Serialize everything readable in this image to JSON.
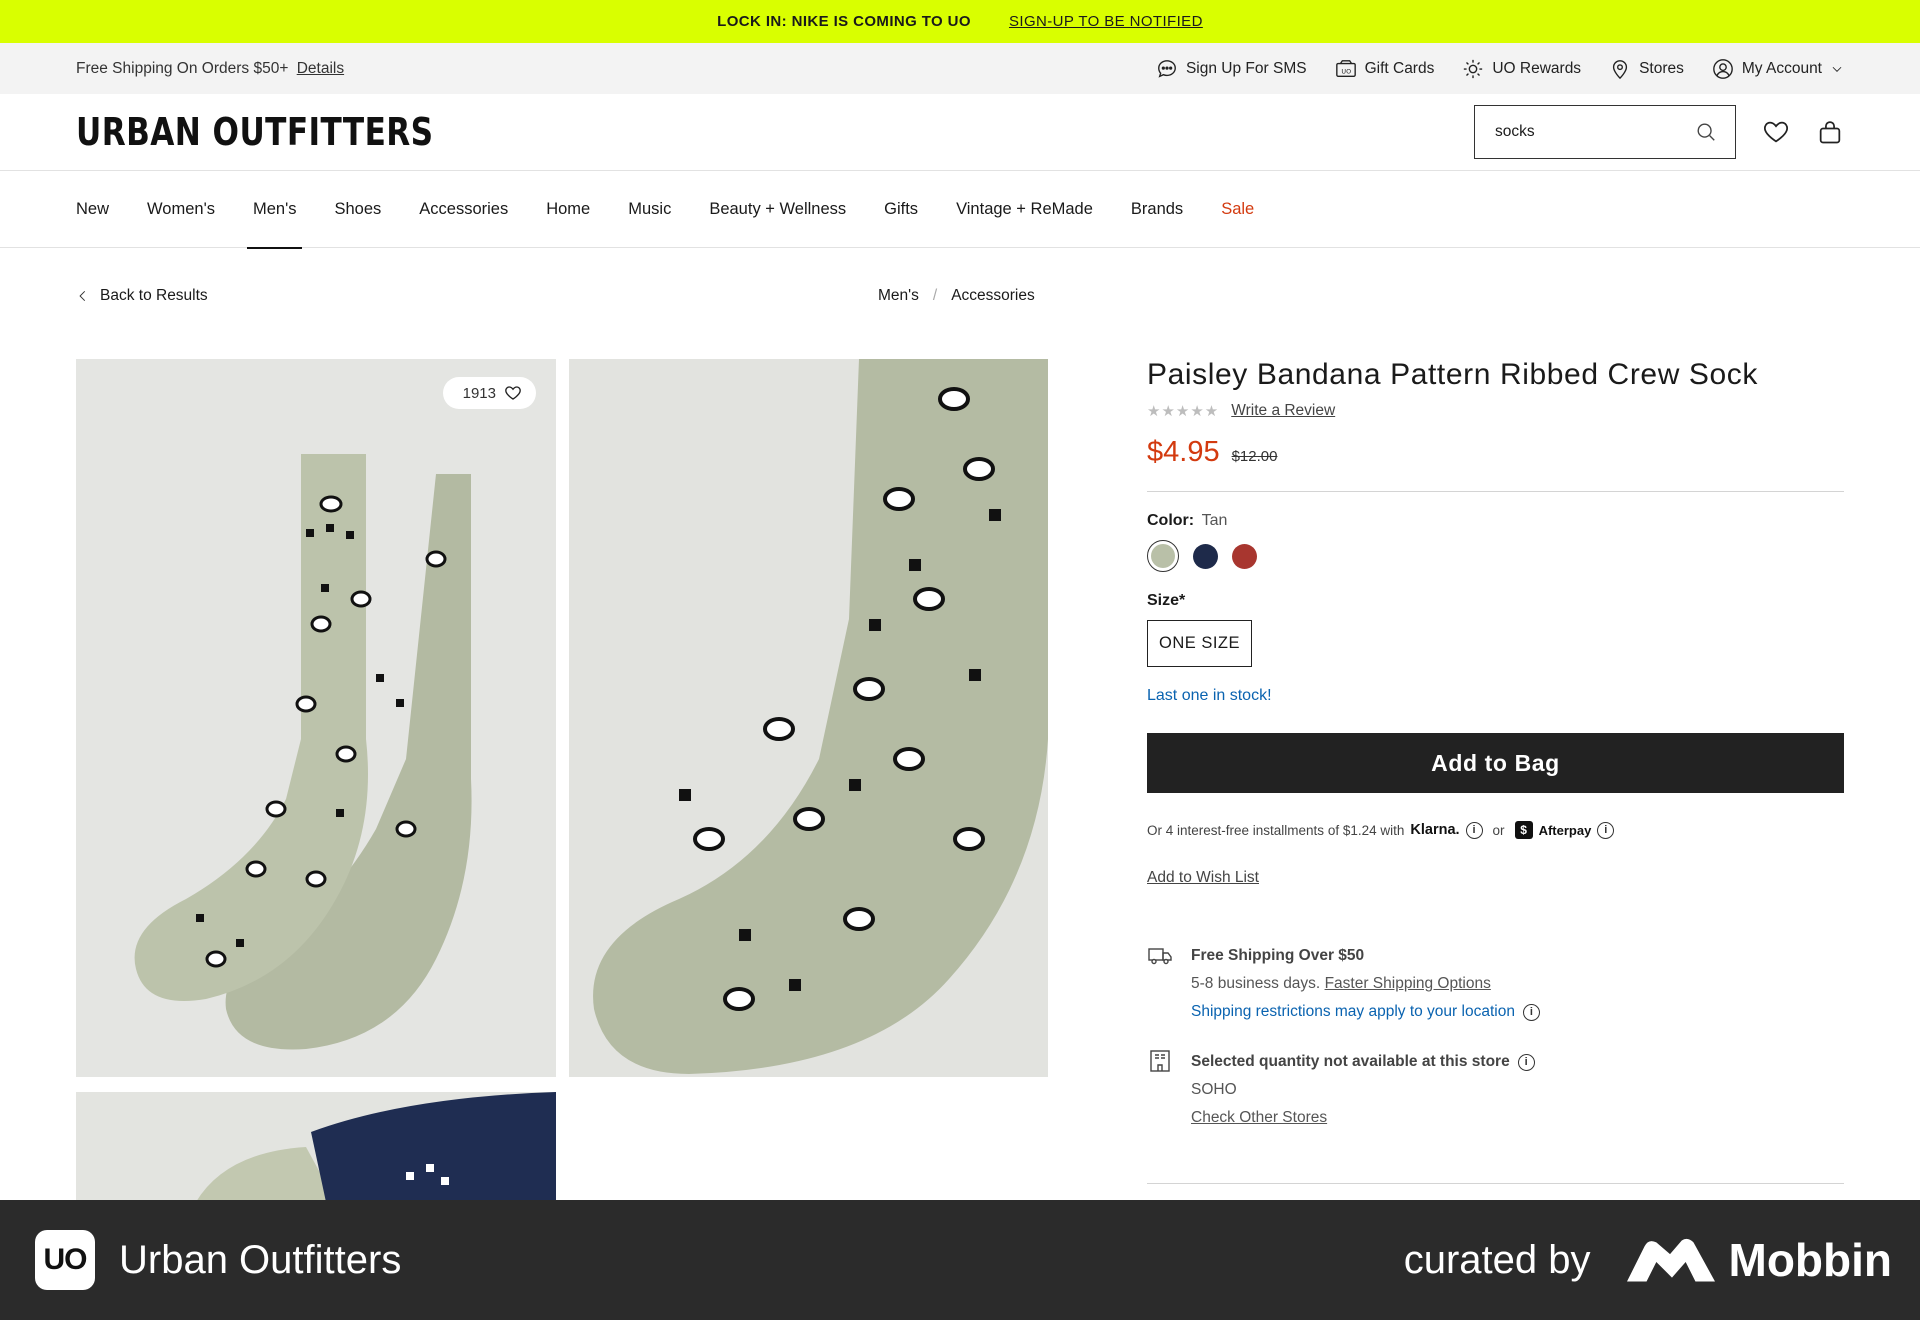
{
  "promo": {
    "headline": "LOCK IN: NIKE IS COMING TO UO",
    "cta": "SIGN-UP TO BE NOTIFIED"
  },
  "utility": {
    "shipping_text": "Free Shipping On Orders $50+",
    "details_link": "Details",
    "items": [
      "Sign Up For SMS",
      "Gift Cards",
      "UO Rewards",
      "Stores",
      "My Account"
    ]
  },
  "header": {
    "logo": "URBAN OUTFITTERS",
    "search_value": "socks"
  },
  "nav": [
    "New",
    "Women's",
    "Men's",
    "Shoes",
    "Accessories",
    "Home",
    "Music",
    "Beauty + Wellness",
    "Gifts",
    "Vintage + ReMade",
    "Brands",
    "Sale"
  ],
  "breadcrumb": {
    "back": "Back to Results",
    "crumbs": [
      "Men's",
      "Accessories"
    ],
    "separator": "/"
  },
  "gallery": {
    "favorites_count": "1913"
  },
  "product": {
    "title": "Paisley Bandana Pattern Ribbed Crew Sock",
    "stars": "★★★★★",
    "review_link": "Write a Review",
    "price": "$4.95",
    "original_price": "$12.00",
    "color_label": "Color:",
    "color_value": "Tan",
    "swatches": [
      "#b9c0a8",
      "#1e2a4a",
      "#a8362f"
    ],
    "size_label": "Size*",
    "size_value": "ONE SIZE",
    "stock_text": "Last one in stock!",
    "add_to_bag": "Add to Bag",
    "installments_text": "Or 4 interest-free installments of $1.24 with",
    "klarna": "Klarna.",
    "or_text": "or",
    "afterpay": "Afterpay",
    "wishlist_link": "Add to Wish List"
  },
  "shipping": {
    "title": "Free Shipping Over $50",
    "days": "5-8 business days.",
    "faster_link": "Faster Shipping Options",
    "restrictions": "Shipping restrictions may apply to your location"
  },
  "store": {
    "title": "Selected quantity not available at this store",
    "name": "SOHO",
    "check_link": "Check Other Stores"
  },
  "footer": {
    "app_badge": "UO",
    "app_name": "Urban Outfitters",
    "curated": "curated by",
    "brand": "Mobbin"
  },
  "colors": {
    "promo": "#d9ff00",
    "accent": "#d33a0f",
    "link_blue": "#0a63b0",
    "button": "#222222"
  }
}
